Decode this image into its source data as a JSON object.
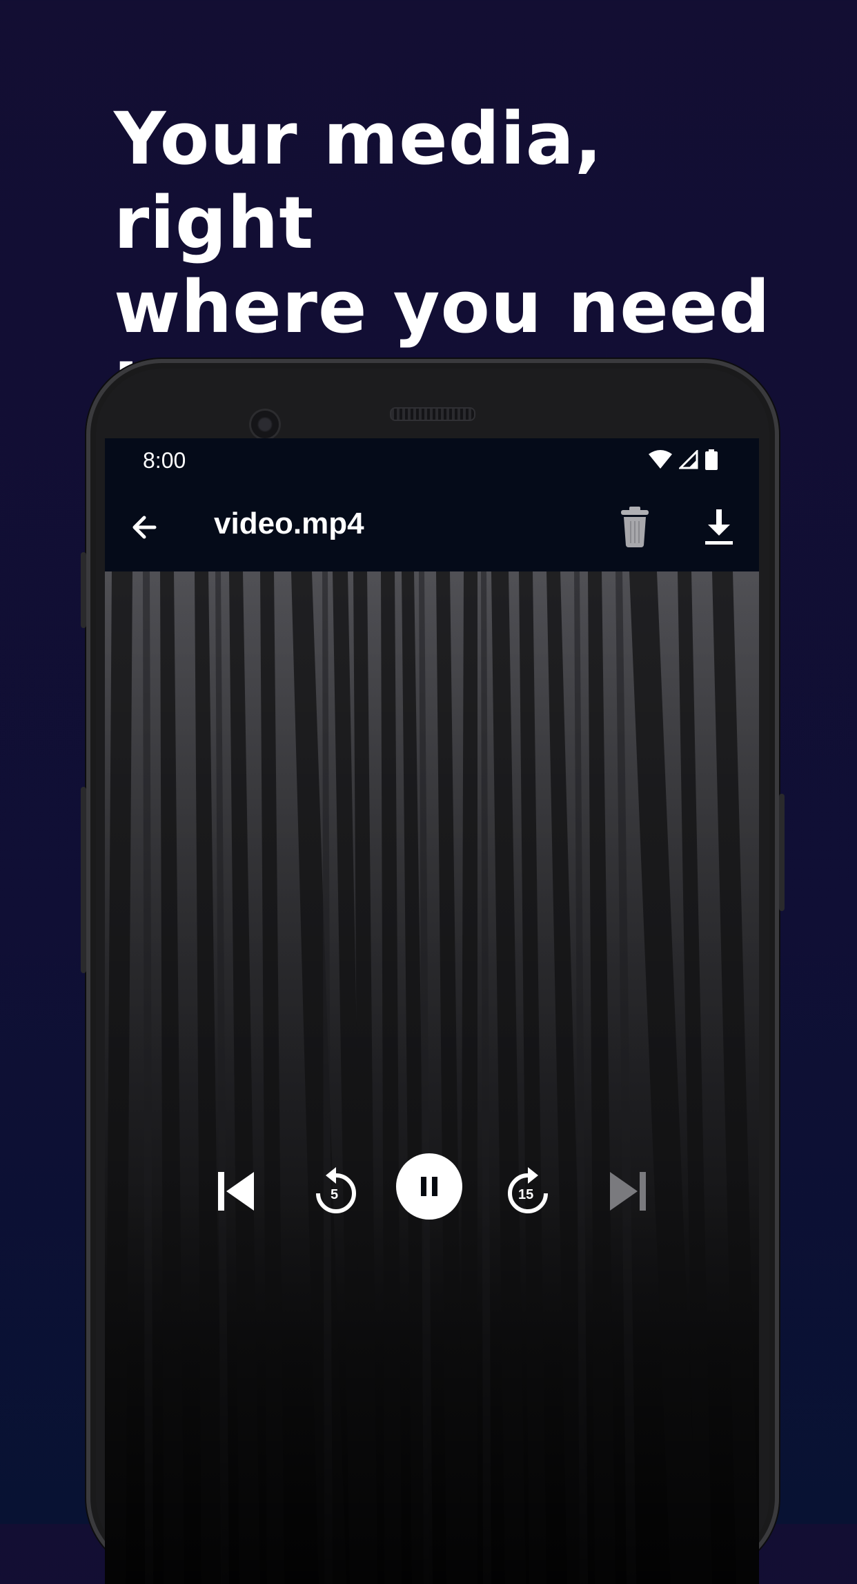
{
  "headline": {
    "line1": "Your media, right",
    "line2": "where you need it."
  },
  "status_bar": {
    "time": "8:00"
  },
  "app_bar": {
    "title": "video.mp4"
  },
  "player": {
    "rewind_seconds": "5",
    "forward_seconds": "15",
    "state": "playing"
  },
  "icons": [
    "back-arrow-icon",
    "trash-icon",
    "download-icon",
    "wifi-icon",
    "signal-icon",
    "battery-icon",
    "skip-previous-icon",
    "replay-5-icon",
    "pause-icon",
    "forward-15-icon",
    "skip-next-icon"
  ],
  "colors": {
    "background": "#120e35",
    "appbar": "#050b19",
    "text": "#ffffff",
    "disabled": "#7a7a7e"
  }
}
